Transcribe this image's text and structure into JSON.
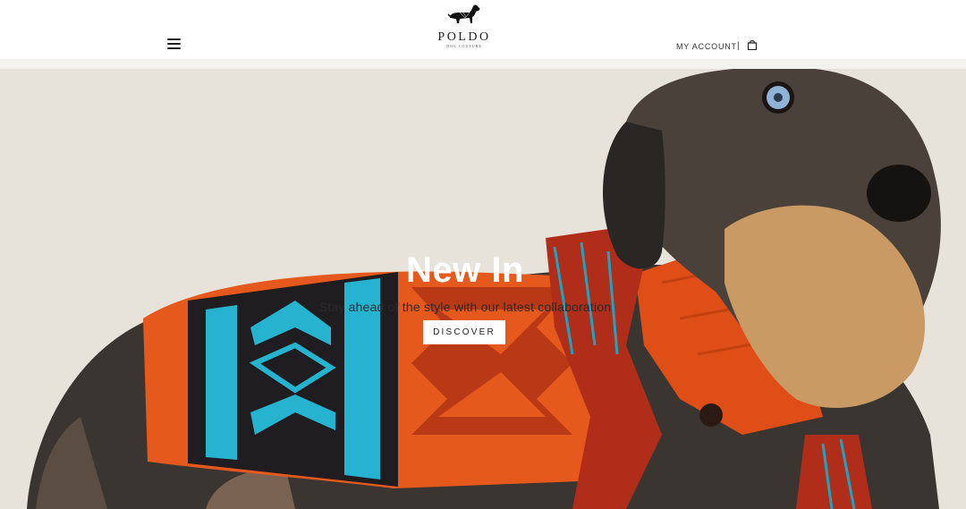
{
  "header": {
    "menu_icon": "hamburger-menu-icon",
    "logo": {
      "name": "POLDO",
      "tagline": "DOG COUTURE",
      "icon": "dachshund-logo-icon"
    },
    "account_label": "MY ACCOUNT",
    "separator": "|",
    "bag_icon": "shopping-bag-icon"
  },
  "hero": {
    "title": "New In",
    "subtitle": "Stay ahead of the style with our latest collaboration",
    "cta_label": "DISCOVER",
    "image": "dachshund-in-orange-knit-sweater-photo"
  },
  "colors": {
    "header_bg": "#ffffff",
    "hero_bg": "#e7e3da",
    "sweater_orange": "#e5591d",
    "sweater_turquoise": "#26b3cf",
    "text_dark": "#222222"
  }
}
